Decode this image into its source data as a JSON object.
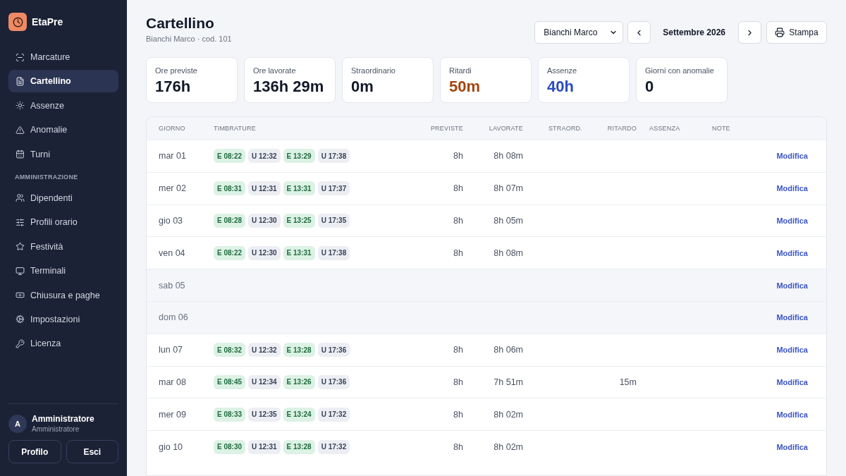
{
  "sidebar": {
    "brand": "EtaPre",
    "groups": [
      {
        "items": [
          {
            "label": "Marcature",
            "selected": false
          },
          {
            "label": "Cartellino",
            "selected": true
          },
          {
            "label": "Assenze",
            "selected": false
          },
          {
            "label": "Anomalie",
            "selected": false
          },
          {
            "label": "Turni",
            "selected": false
          }
        ]
      },
      {
        "title": "AMMINISTRAZIONE",
        "items": [
          {
            "label": "Dipendenti",
            "selected": false
          },
          {
            "label": "Profili orario",
            "selected": false
          },
          {
            "label": "Festività",
            "selected": false
          },
          {
            "label": "Terminali",
            "selected": false
          },
          {
            "label": "Chiusura e paghe",
            "selected": false
          },
          {
            "label": "Impostazioni",
            "selected": false
          },
          {
            "label": "Licenza",
            "selected": false
          }
        ]
      }
    ],
    "user": {
      "initial": "A",
      "name": "Amministratore",
      "role": "Amministratore"
    },
    "buttons": [
      "Profilo",
      "Esci"
    ]
  },
  "header": {
    "title": "Cartellino",
    "subtitle": "Bianchi Marco · cod. 101",
    "employee_select": {
      "value": "Bianchi Marco"
    },
    "period": "Settembre 2026",
    "print_button": "Stampa"
  },
  "stats": [
    {
      "label": "Ore previste",
      "value": "176h",
      "color": "#111827"
    },
    {
      "label": "Ore lavorate",
      "value": "136h 29m",
      "color": "#111827"
    },
    {
      "label": "Straordinario",
      "value": "0m",
      "color": "#111827"
    },
    {
      "label": "Ritardi",
      "value": "50m",
      "color": "#a3450f"
    },
    {
      "label": "Assenze",
      "value": "40h",
      "color": "#2c4bbf"
    },
    {
      "label": "Giorni con anomalie",
      "value": "0",
      "color": "#111827"
    }
  ],
  "table": {
    "columns": [
      "GIORNO",
      "TIMBRATURE",
      "PREVISTE",
      "LAVORATE",
      "STRAORD.",
      "RITARDO",
      "ASSENZA",
      "NOTE"
    ],
    "rows": [
      {
        "day": "mar 01",
        "weekend": false,
        "stamps": [
          {
            "label": "E 08:22",
            "kind": "entry"
          },
          {
            "label": "U 12:32",
            "kind": "exit"
          },
          {
            "label": "E 13:29",
            "kind": "entry"
          },
          {
            "label": "U 17:38",
            "kind": "exit"
          }
        ],
        "planned": "8h",
        "worked": "8h 08m",
        "action": "Modifica"
      },
      {
        "day": "mer 02",
        "weekend": false,
        "stamps": [
          {
            "label": "E 08:31",
            "kind": "entry"
          },
          {
            "label": "U 12:31",
            "kind": "exit"
          },
          {
            "label": "E 13:31",
            "kind": "entry"
          },
          {
            "label": "U 17:37",
            "kind": "exit"
          }
        ],
        "planned": "8h",
        "worked": "8h 07m",
        "action": "Modifica"
      },
      {
        "day": "gio 03",
        "weekend": false,
        "stamps": [
          {
            "label": "E 08:28",
            "kind": "entry"
          },
          {
            "label": "U 12:30",
            "kind": "exit"
          },
          {
            "label": "E 13:25",
            "kind": "entry"
          },
          {
            "label": "U 17:35",
            "kind": "exit"
          }
        ],
        "planned": "8h",
        "worked": "8h 05m",
        "action": "Modifica"
      },
      {
        "day": "ven 04",
        "weekend": false,
        "stamps": [
          {
            "label": "E 08:22",
            "kind": "entry"
          },
          {
            "label": "U 12:30",
            "kind": "exit"
          },
          {
            "label": "E 13:31",
            "kind": "entry"
          },
          {
            "label": "U 17:38",
            "kind": "exit"
          }
        ],
        "planned": "8h",
        "worked": "8h 08m",
        "action": "Modifica"
      },
      {
        "day": "sab 05",
        "weekend": true,
        "action": "Modifica"
      },
      {
        "day": "dom 06",
        "weekend": true,
        "action": "Modifica"
      },
      {
        "day": "lun 07",
        "weekend": false,
        "stamps": [
          {
            "label": "E 08:32",
            "kind": "entry"
          },
          {
            "label": "U 12:32",
            "kind": "exit"
          },
          {
            "label": "E 13:28",
            "kind": "entry"
          },
          {
            "label": "U 17:36",
            "kind": "exit"
          }
        ],
        "planned": "8h",
        "worked": "8h 06m",
        "action": "Modifica"
      },
      {
        "day": "mar 08",
        "weekend": false,
        "stamps": [
          {
            "label": "E 08:45",
            "kind": "entry"
          },
          {
            "label": "U 12:34",
            "kind": "exit"
          },
          {
            "label": "E 13:26",
            "kind": "entry"
          },
          {
            "label": "U 17:36",
            "kind": "exit"
          }
        ],
        "planned": "8h",
        "worked": "7h 51m",
        "late": "15m",
        "action": "Modifica"
      },
      {
        "day": "mer 09",
        "weekend": false,
        "stamps": [
          {
            "label": "E 08:33",
            "kind": "entry"
          },
          {
            "label": "U 12:35",
            "kind": "exit"
          },
          {
            "label": "E 13:24",
            "kind": "entry"
          },
          {
            "label": "U 17:32",
            "kind": "exit"
          }
        ],
        "planned": "8h",
        "worked": "8h 02m",
        "action": "Modifica"
      },
      {
        "day": "gio 10",
        "weekend": false,
        "stamps": [
          {
            "label": "E 08:30",
            "kind": "entry"
          },
          {
            "label": "U 12:31",
            "kind": "exit"
          },
          {
            "label": "E 13:28",
            "kind": "entry"
          },
          {
            "label": "U 17:32",
            "kind": "exit"
          }
        ],
        "planned": "8h",
        "worked": "8h 02m",
        "action": "Modifica"
      }
    ]
  }
}
